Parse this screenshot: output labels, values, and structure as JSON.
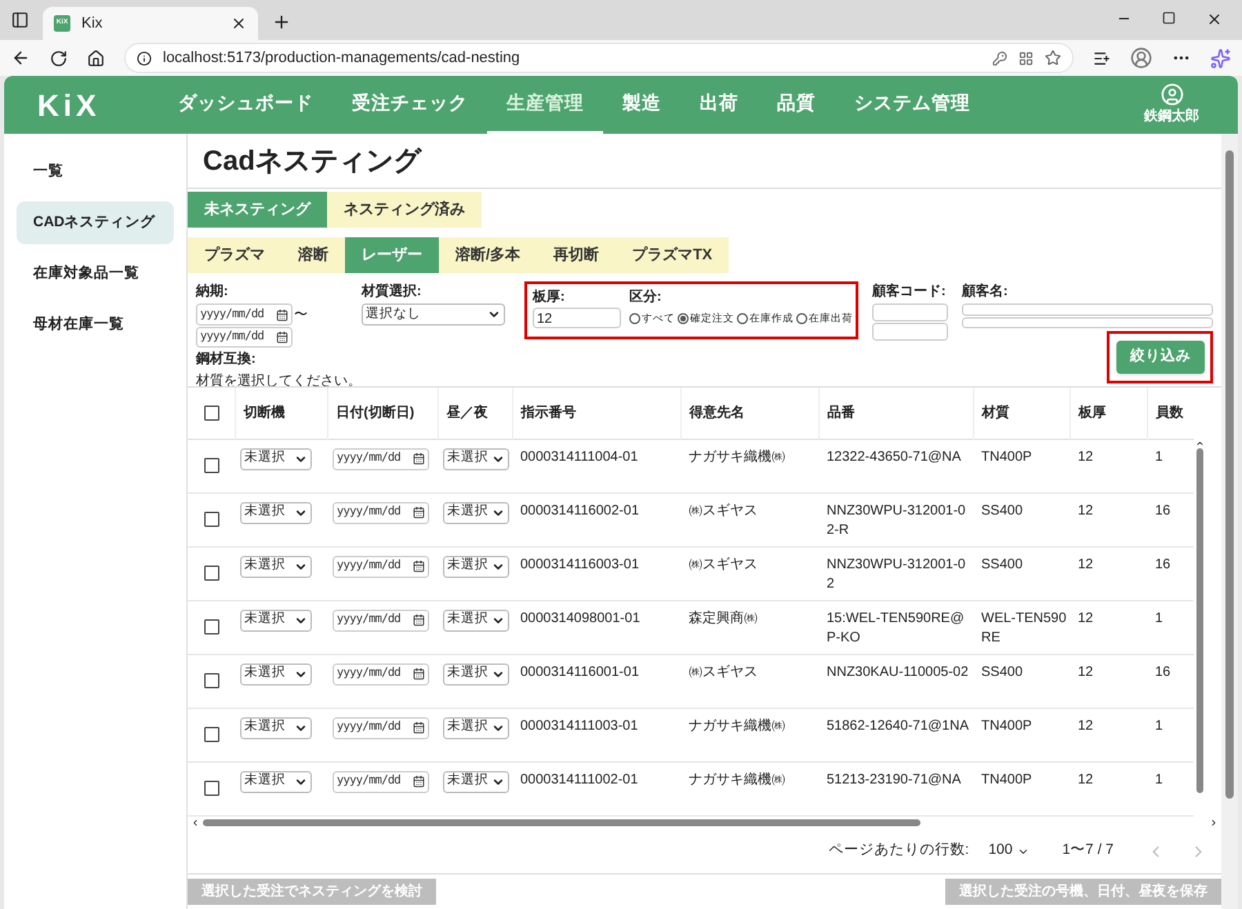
{
  "browser": {
    "tab_title": "Kix",
    "favicon": "KiX",
    "url": "localhost:5173/production-managements/cad-nesting"
  },
  "header": {
    "logo": "KiX",
    "nav": [
      {
        "label": "ダッシュボード",
        "selected": false
      },
      {
        "label": "受注チェック",
        "selected": false
      },
      {
        "label": "生産管理",
        "selected": true
      },
      {
        "label": "製造",
        "selected": false
      },
      {
        "label": "出荷",
        "selected": false
      },
      {
        "label": "品質",
        "selected": false
      },
      {
        "label": "システム管理",
        "selected": false
      }
    ],
    "user": "鉄鋼太郎"
  },
  "sidebar": {
    "items": [
      {
        "label": "一覧",
        "selected": false
      },
      {
        "label": "CADネスティング",
        "selected": true
      },
      {
        "label": "在庫対象品一覧",
        "selected": false
      },
      {
        "label": "母材在庫一覧",
        "selected": false
      }
    ]
  },
  "page_title": "Cadネスティング",
  "status_tabs": [
    {
      "label": "未ネスティング",
      "selected": true
    },
    {
      "label": "ネスティング済み",
      "selected": false
    }
  ],
  "method_tabs": [
    {
      "label": "プラズマ",
      "selected": false
    },
    {
      "label": "溶断",
      "selected": false
    },
    {
      "label": "レーザー",
      "selected": true
    },
    {
      "label": "溶断/多本",
      "selected": false
    },
    {
      "label": "再切断",
      "selected": false
    },
    {
      "label": "プラズマTX",
      "selected": false
    }
  ],
  "filters": {
    "due_label": "納期:",
    "date_from_placeholder": "yyyy/mm/dd",
    "date_sep": "〜",
    "date_to_placeholder": "yyyy/mm/dd",
    "material_label": "材質選択:",
    "material_value": "選択なし",
    "steel_label": "鋼材互換:",
    "steel_note": "材質を選択してください。",
    "thickness_label": "板厚:",
    "thickness_value": "12",
    "category_label": "区分:",
    "categories": [
      {
        "label": "すべて",
        "selected": false
      },
      {
        "label": "確定注文",
        "selected": true
      },
      {
        "label": "在庫作成",
        "selected": false
      },
      {
        "label": "在庫出荷",
        "selected": false
      }
    ],
    "customer_code_label": "顧客コード:",
    "customer_name_label": "顧客名:",
    "filter_button": "絞り込み"
  },
  "table": {
    "select_all_checked": false,
    "columns": [
      "切断機",
      "日付(切断日)",
      "昼／夜",
      "指示番号",
      "得意先名",
      "品番",
      "材質",
      "板厚",
      "員数"
    ],
    "rows": [
      {
        "checked": false,
        "machine": "未選択",
        "date_placeholder": "yyyy/mm/dd",
        "shift": "未選択",
        "order_no": "0000314111004-01",
        "customer": "ナガサキ織機㈱",
        "part_no": "12322-43650-71@NA",
        "material": "TN400P",
        "thickness": "12",
        "qty": "1"
      },
      {
        "checked": false,
        "machine": "未選択",
        "date_placeholder": "yyyy/mm/dd",
        "shift": "未選択",
        "order_no": "0000314116002-01",
        "customer": "㈱スギヤス",
        "part_no": "NNZ30WPU-312001-02-R",
        "material": "SS400",
        "thickness": "12",
        "qty": "16"
      },
      {
        "checked": false,
        "machine": "未選択",
        "date_placeholder": "yyyy/mm/dd",
        "shift": "未選択",
        "order_no": "0000314116003-01",
        "customer": "㈱スギヤス",
        "part_no": "NNZ30WPU-312001-02",
        "material": "SS400",
        "thickness": "12",
        "qty": "16"
      },
      {
        "checked": false,
        "machine": "未選択",
        "date_placeholder": "yyyy/mm/dd",
        "shift": "未選択",
        "order_no": "0000314098001-01",
        "customer": "森定興商㈱",
        "part_no": "15:WEL-TEN590RE@P-KO",
        "material": "WEL-TEN590RE",
        "thickness": "12",
        "qty": "1"
      },
      {
        "checked": false,
        "machine": "未選択",
        "date_placeholder": "yyyy/mm/dd",
        "shift": "未選択",
        "order_no": "0000314116001-01",
        "customer": "㈱スギヤス",
        "part_no": "NNZ30KAU-110005-02",
        "material": "SS400",
        "thickness": "12",
        "qty": "16"
      },
      {
        "checked": false,
        "machine": "未選択",
        "date_placeholder": "yyyy/mm/dd",
        "shift": "未選択",
        "order_no": "0000314111003-01",
        "customer": "ナガサキ織機㈱",
        "part_no": "51862-12640-71@1NA",
        "material": "TN400P",
        "thickness": "12",
        "qty": "1"
      },
      {
        "checked": false,
        "machine": "未選択",
        "date_placeholder": "yyyy/mm/dd",
        "shift": "未選択",
        "order_no": "0000314111002-01",
        "customer": "ナガサキ織機㈱",
        "part_no": "51213-23190-71@NA",
        "material": "TN400P",
        "thickness": "12",
        "qty": "1"
      }
    ]
  },
  "pagination": {
    "rows_per_page_label": "ページあたりの行数:",
    "rows_per_page": "100",
    "range": "1〜7 / 7"
  },
  "actions": [
    {
      "label": "選択した受注でネスティングを検討",
      "disabled": true
    },
    {
      "label": "選択した受注の号機、日付、昼夜を保存",
      "disabled": true
    }
  ]
}
